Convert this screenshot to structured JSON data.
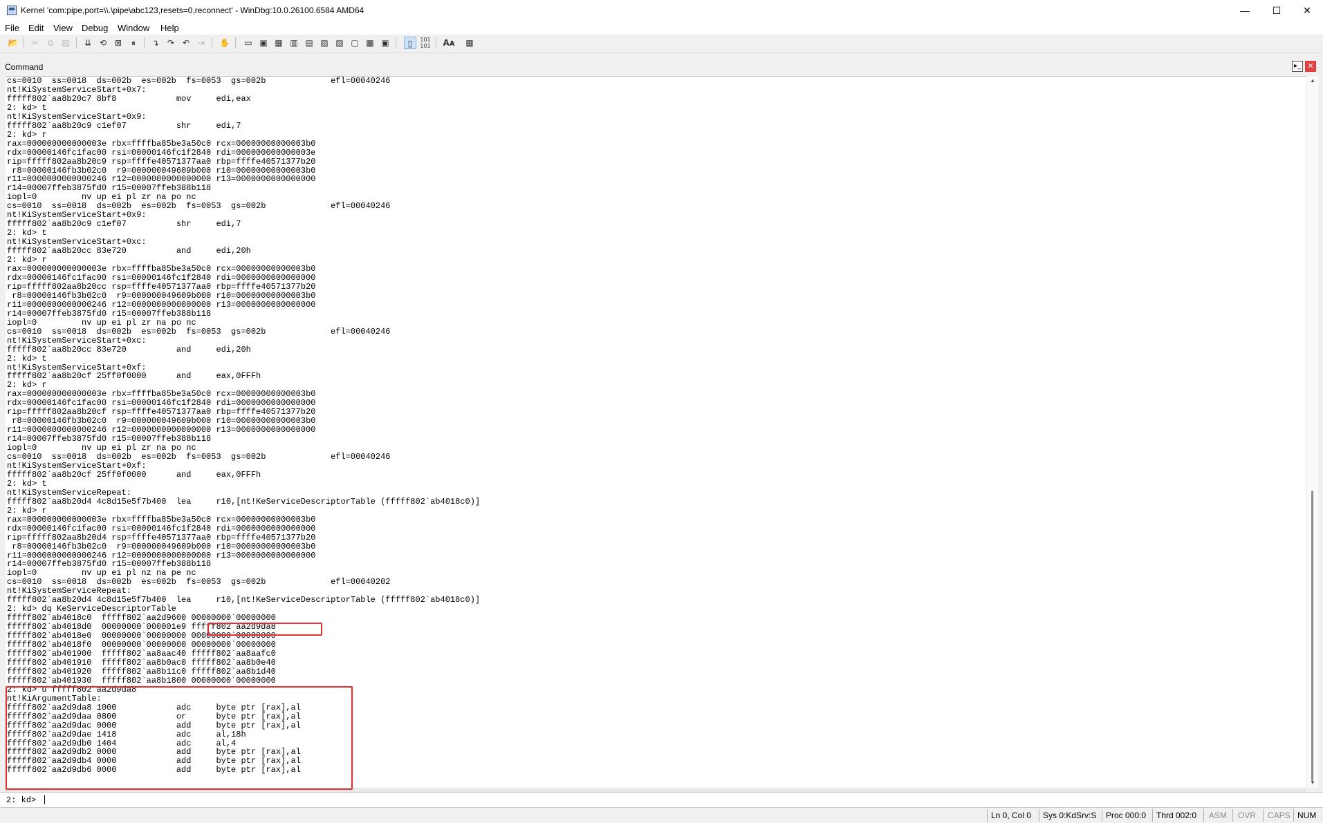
{
  "window": {
    "title": "Kernel 'com:pipe,port=\\\\.\\pipe\\abc123,resets=0,reconnect' - WinDbg:10.0.26100.6584 AMD64",
    "minimize_glyph": "—",
    "maximize_glyph": "☐",
    "close_glyph": "✕"
  },
  "menu": {
    "items": [
      "File",
      "Edit",
      "View",
      "Debug",
      "Window",
      "Help"
    ]
  },
  "command_window": {
    "title": "Command",
    "output": [
      "cs=0010  ss=0018  ds=002b  es=002b  fs=0053  gs=002b             efl=00040246",
      "nt!KiSystemServiceStart+0x7:",
      "fffff802`aa8b20c7 8bf8            mov     edi,eax",
      "2: kd> t",
      "nt!KiSystemServiceStart+0x9:",
      "fffff802`aa8b20c9 c1ef07          shr     edi,7",
      "2: kd> r",
      "rax=000000000000003e rbx=ffffba85be3a50c0 rcx=00000000000003b0",
      "rdx=00000146fc1fac00 rsi=00000146fc1f2840 rdi=000000000000003e",
      "rip=fffff802aa8b20c9 rsp=ffffe40571377aa0 rbp=ffffe40571377b20",
      " r8=00000146fb3b02c0  r9=000000049609b000 r10=00000000000003b0",
      "r11=0000000000000246 r12=0000000000000000 r13=0000000000000000",
      "r14=00007ffeb3875fd0 r15=00007ffeb388b118",
      "iopl=0         nv up ei pl zr na po nc",
      "cs=0010  ss=0018  ds=002b  es=002b  fs=0053  gs=002b             efl=00040246",
      "nt!KiSystemServiceStart+0x9:",
      "fffff802`aa8b20c9 c1ef07          shr     edi,7",
      "2: kd> t",
      "nt!KiSystemServiceStart+0xc:",
      "fffff802`aa8b20cc 83e720          and     edi,20h",
      "2: kd> r",
      "rax=000000000000003e rbx=ffffba85be3a50c0 rcx=00000000000003b0",
      "rdx=00000146fc1fac00 rsi=00000146fc1f2840 rdi=0000000000000000",
      "rip=fffff802aa8b20cc rsp=ffffe40571377aa0 rbp=ffffe40571377b20",
      " r8=00000146fb3b02c0  r9=000000049609b000 r10=00000000000003b0",
      "r11=0000000000000246 r12=0000000000000000 r13=0000000000000000",
      "r14=00007ffeb3875fd0 r15=00007ffeb388b118",
      "iopl=0         nv up ei pl zr na po nc",
      "cs=0010  ss=0018  ds=002b  es=002b  fs=0053  gs=002b             efl=00040246",
      "nt!KiSystemServiceStart+0xc:",
      "fffff802`aa8b20cc 83e720          and     edi,20h",
      "2: kd> t",
      "nt!KiSystemServiceStart+0xf:",
      "fffff802`aa8b20cf 25ff0f0000      and     eax,0FFFh",
      "2: kd> r",
      "rax=000000000000003e rbx=ffffba85be3a50c0 rcx=00000000000003b0",
      "rdx=00000146fc1fac00 rsi=00000146fc1f2840 rdi=0000000000000000",
      "rip=fffff802aa8b20cf rsp=ffffe40571377aa0 rbp=ffffe40571377b20",
      " r8=00000146fb3b02c0  r9=000000049609b000 r10=00000000000003b0",
      "r11=0000000000000246 r12=0000000000000000 r13=0000000000000000",
      "r14=00007ffeb3875fd0 r15=00007ffeb388b118",
      "iopl=0         nv up ei pl zr na po nc",
      "cs=0010  ss=0018  ds=002b  es=002b  fs=0053  gs=002b             efl=00040246",
      "nt!KiSystemServiceStart+0xf:",
      "fffff802`aa8b20cf 25ff0f0000      and     eax,0FFFh",
      "2: kd> t",
      "nt!KiSystemServiceRepeat:",
      "fffff802`aa8b20d4 4c8d15e5f7b400  lea     r10,[nt!KeServiceDescriptorTable (fffff802`ab4018c0)]",
      "2: kd> r",
      "rax=000000000000003e rbx=ffffba85be3a50c0 rcx=00000000000003b0",
      "rdx=00000146fc1fac00 rsi=00000146fc1f2840 rdi=0000000000000000",
      "rip=fffff802aa8b20d4 rsp=ffffe40571377aa0 rbp=ffffe40571377b20",
      " r8=00000146fb3b02c0  r9=000000049609b000 r10=00000000000003b0",
      "r11=0000000000000246 r12=0000000000000000 r13=0000000000000000",
      "r14=00007ffeb3875fd0 r15=00007ffeb388b118",
      "iopl=0         nv up ei pl nz na pe nc",
      "cs=0010  ss=0018  ds=002b  es=002b  fs=0053  gs=002b             efl=00040202",
      "nt!KiSystemServiceRepeat:",
      "fffff802`aa8b20d4 4c8d15e5f7b400  lea     r10,[nt!KeServiceDescriptorTable (fffff802`ab4018c0)]",
      "2: kd> dq KeServiceDescriptorTable",
      "fffff802`ab4018c0  fffff802`aa2d9600 00000000`00000000",
      "fffff802`ab4018d0  00000000`000001e9 fffff802`aa2d9da8",
      "fffff802`ab4018e0  00000000`00000000 00000000`00000000",
      "fffff802`ab4018f0  00000000`00000000 00000000`00000000",
      "fffff802`ab401900  fffff802`aa8aac40 fffff802`aa8aafc0",
      "fffff802`ab401910  fffff802`aa8b0ac0 fffff802`aa8b0e40",
      "fffff802`ab401920  fffff802`aa8b11c0 fffff802`aa8b1d40",
      "fffff802`ab401930  fffff802`aa8b1800 00000000`00000000",
      "2: kd> u fffff802`aa2d9da8",
      "nt!KiArgumentTable:",
      "fffff802`aa2d9da8 1000            adc     byte ptr [rax],al",
      "fffff802`aa2d9daa 0800            or      byte ptr [rax],al",
      "fffff802`aa2d9dac 0000            add     byte ptr [rax],al",
      "fffff802`aa2d9dae 1418            adc     al,18h",
      "fffff802`aa2d9db0 1404            adc     al,4",
      "fffff802`aa2d9db2 0000            add     byte ptr [rax],al",
      "fffff802`aa2d9db4 0000            add     byte ptr [rax],al",
      "fffff802`aa2d9db6 0000            add     byte ptr [rax],al"
    ],
    "prompt": "2: kd>",
    "input_value": ""
  },
  "status_bar": {
    "ln_col": "Ln 0, Col 0",
    "sys": "Sys 0:KdSrv:S",
    "proc": "Proc 000:0",
    "thrd": "Thrd 002:0",
    "asm": "ASM",
    "ovr": "OVR",
    "caps": "CAPS",
    "num": "NUM"
  },
  "colors": {
    "highlight": "#e03030",
    "background": "#ffffff",
    "chrome": "#f0f0f0"
  }
}
